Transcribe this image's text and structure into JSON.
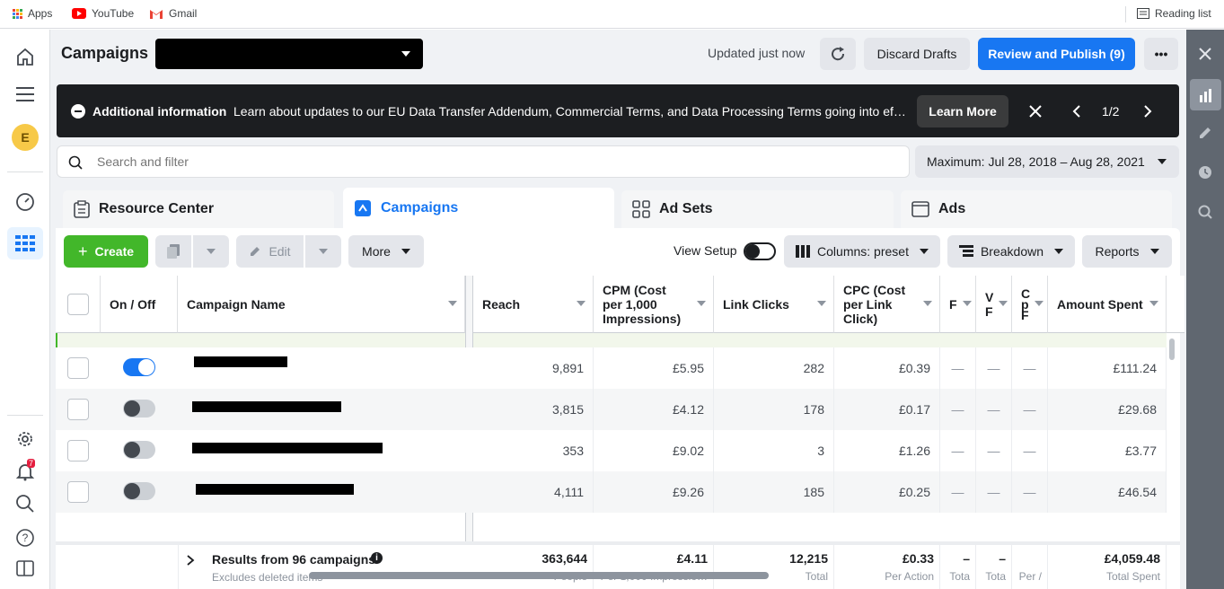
{
  "bookmarks": {
    "apps": "Apps",
    "youtube": "YouTube",
    "gmail": "Gmail",
    "reading_list": "Reading list"
  },
  "header": {
    "title": "Campaigns",
    "updated": "Updated just now",
    "discard": "Discard Drafts",
    "publish": "Review and Publish (9)"
  },
  "banner": {
    "title": "Additional information",
    "text": "Learn about updates to our EU Data Transfer Addendum, Commercial Terms, and Data Processing Terms going into ef…",
    "learn_more": "Learn More",
    "pager": "1/2"
  },
  "search": {
    "placeholder": "Search and filter",
    "date_range": "Maximum: Jul 28, 2018 – Aug 28, 2021"
  },
  "tabs": [
    {
      "label": "Resource Center"
    },
    {
      "label": "Campaigns"
    },
    {
      "label": "Ad Sets"
    },
    {
      "label": "Ads"
    }
  ],
  "toolbar": {
    "create": "Create",
    "edit": "Edit",
    "more": "More",
    "view_setup": "View Setup",
    "columns": "Columns: preset",
    "breakdown": "Breakdown",
    "reports": "Reports"
  },
  "table": {
    "headers": {
      "onoff": "On / Off",
      "name": "Campaign Name",
      "reach": "Reach",
      "cpm": "CPM (Cost per 1,000 Impressions)",
      "clicks": "Link Clicks",
      "cpc": "CPC (Cost per Link Click)",
      "amount": "Amount Spent",
      "narrow1": "F",
      "narrow2": "V F",
      "narrow3": "C p F"
    },
    "rows": [
      {
        "on": true,
        "reach": "9,891",
        "cpm": "£5.95",
        "clicks": "282",
        "cpc": "£0.39",
        "c1": "—",
        "c2": "—",
        "c3": "—",
        "amount": "£111.24"
      },
      {
        "on": false,
        "reach": "3,815",
        "cpm": "£4.12",
        "clicks": "178",
        "cpc": "£0.17",
        "c1": "—",
        "c2": "—",
        "c3": "—",
        "amount": "£29.68"
      },
      {
        "on": false,
        "reach": "353",
        "cpm": "£9.02",
        "clicks": "3",
        "cpc": "£1.26",
        "c1": "—",
        "c2": "—",
        "c3": "—",
        "amount": "£3.77"
      },
      {
        "on": false,
        "reach": "4,111",
        "cpm": "£9.26",
        "clicks": "185",
        "cpc": "£0.25",
        "c1": "—",
        "c2": "—",
        "c3": "—",
        "amount": "£46.54"
      }
    ],
    "footer": {
      "title": "Results from 96 campaigns",
      "subtitle": "Excludes deleted items",
      "reach": "363,644",
      "reach_sub": "People",
      "cpm": "£4.11",
      "cpm_sub": "Per 1,000 Impressio…",
      "clicks": "12,215",
      "clicks_sub": "Total",
      "cpc": "£0.33",
      "cpc_sub": "Per Action",
      "c1": "–",
      "c1_sub": "Tota",
      "c2": "–",
      "c2_sub": "Tota",
      "c3_sub": "Per /",
      "amount": "£4,059.48",
      "amount_sub": "Total Spent"
    }
  },
  "leftnav": {
    "avatar": "E",
    "notif_count": "7"
  },
  "colors": {
    "primary": "#1877f2",
    "create_green": "#42b72a",
    "banner_bg": "#1c1e21"
  }
}
